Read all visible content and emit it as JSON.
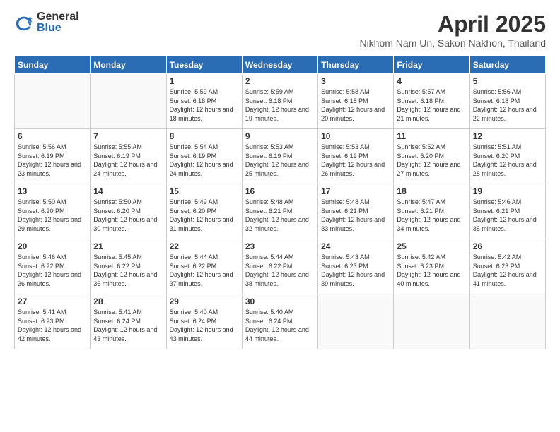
{
  "logo": {
    "general": "General",
    "blue": "Blue"
  },
  "title": "April 2025",
  "subtitle": "Nikhom Nam Un, Sakon Nakhon, Thailand",
  "days_of_week": [
    "Sunday",
    "Monday",
    "Tuesday",
    "Wednesday",
    "Thursday",
    "Friday",
    "Saturday"
  ],
  "weeks": [
    [
      {
        "day": "",
        "empty": true
      },
      {
        "day": "",
        "empty": true
      },
      {
        "day": "1",
        "sunrise": "5:59 AM",
        "sunset": "6:18 PM",
        "daylight": "12 hours and 18 minutes."
      },
      {
        "day": "2",
        "sunrise": "5:59 AM",
        "sunset": "6:18 PM",
        "daylight": "12 hours and 19 minutes."
      },
      {
        "day": "3",
        "sunrise": "5:58 AM",
        "sunset": "6:18 PM",
        "daylight": "12 hours and 20 minutes."
      },
      {
        "day": "4",
        "sunrise": "5:57 AM",
        "sunset": "6:18 PM",
        "daylight": "12 hours and 21 minutes."
      },
      {
        "day": "5",
        "sunrise": "5:56 AM",
        "sunset": "6:18 PM",
        "daylight": "12 hours and 22 minutes."
      }
    ],
    [
      {
        "day": "6",
        "sunrise": "5:56 AM",
        "sunset": "6:19 PM",
        "daylight": "12 hours and 23 minutes."
      },
      {
        "day": "7",
        "sunrise": "5:55 AM",
        "sunset": "6:19 PM",
        "daylight": "12 hours and 24 minutes."
      },
      {
        "day": "8",
        "sunrise": "5:54 AM",
        "sunset": "6:19 PM",
        "daylight": "12 hours and 24 minutes."
      },
      {
        "day": "9",
        "sunrise": "5:53 AM",
        "sunset": "6:19 PM",
        "daylight": "12 hours and 25 minutes."
      },
      {
        "day": "10",
        "sunrise": "5:53 AM",
        "sunset": "6:19 PM",
        "daylight": "12 hours and 26 minutes."
      },
      {
        "day": "11",
        "sunrise": "5:52 AM",
        "sunset": "6:20 PM",
        "daylight": "12 hours and 27 minutes."
      },
      {
        "day": "12",
        "sunrise": "5:51 AM",
        "sunset": "6:20 PM",
        "daylight": "12 hours and 28 minutes."
      }
    ],
    [
      {
        "day": "13",
        "sunrise": "5:50 AM",
        "sunset": "6:20 PM",
        "daylight": "12 hours and 29 minutes."
      },
      {
        "day": "14",
        "sunrise": "5:50 AM",
        "sunset": "6:20 PM",
        "daylight": "12 hours and 30 minutes."
      },
      {
        "day": "15",
        "sunrise": "5:49 AM",
        "sunset": "6:20 PM",
        "daylight": "12 hours and 31 minutes."
      },
      {
        "day": "16",
        "sunrise": "5:48 AM",
        "sunset": "6:21 PM",
        "daylight": "12 hours and 32 minutes."
      },
      {
        "day": "17",
        "sunrise": "5:48 AM",
        "sunset": "6:21 PM",
        "daylight": "12 hours and 33 minutes."
      },
      {
        "day": "18",
        "sunrise": "5:47 AM",
        "sunset": "6:21 PM",
        "daylight": "12 hours and 34 minutes."
      },
      {
        "day": "19",
        "sunrise": "5:46 AM",
        "sunset": "6:21 PM",
        "daylight": "12 hours and 35 minutes."
      }
    ],
    [
      {
        "day": "20",
        "sunrise": "5:46 AM",
        "sunset": "6:22 PM",
        "daylight": "12 hours and 36 minutes."
      },
      {
        "day": "21",
        "sunrise": "5:45 AM",
        "sunset": "6:22 PM",
        "daylight": "12 hours and 36 minutes."
      },
      {
        "day": "22",
        "sunrise": "5:44 AM",
        "sunset": "6:22 PM",
        "daylight": "12 hours and 37 minutes."
      },
      {
        "day": "23",
        "sunrise": "5:44 AM",
        "sunset": "6:22 PM",
        "daylight": "12 hours and 38 minutes."
      },
      {
        "day": "24",
        "sunrise": "5:43 AM",
        "sunset": "6:23 PM",
        "daylight": "12 hours and 39 minutes."
      },
      {
        "day": "25",
        "sunrise": "5:42 AM",
        "sunset": "6:23 PM",
        "daylight": "12 hours and 40 minutes."
      },
      {
        "day": "26",
        "sunrise": "5:42 AM",
        "sunset": "6:23 PM",
        "daylight": "12 hours and 41 minutes."
      }
    ],
    [
      {
        "day": "27",
        "sunrise": "5:41 AM",
        "sunset": "6:23 PM",
        "daylight": "12 hours and 42 minutes."
      },
      {
        "day": "28",
        "sunrise": "5:41 AM",
        "sunset": "6:24 PM",
        "daylight": "12 hours and 43 minutes."
      },
      {
        "day": "29",
        "sunrise": "5:40 AM",
        "sunset": "6:24 PM",
        "daylight": "12 hours and 43 minutes."
      },
      {
        "day": "30",
        "sunrise": "5:40 AM",
        "sunset": "6:24 PM",
        "daylight": "12 hours and 44 minutes."
      },
      {
        "day": "",
        "empty": true
      },
      {
        "day": "",
        "empty": true
      },
      {
        "day": "",
        "empty": true
      }
    ]
  ]
}
